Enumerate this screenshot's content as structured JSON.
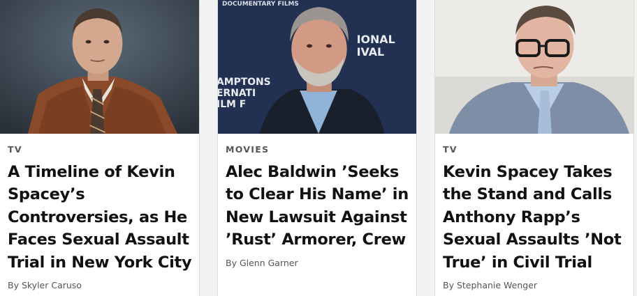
{
  "articles": [
    {
      "category": "TV",
      "headline": "A Timeline of Kevin Spacey’s Controversies, as He Faces Sexual Assault Trial in New York City",
      "byline": "By Skyler Caruso"
    },
    {
      "category": "MOVIES",
      "headline": "Alec Baldwin ’Seeks to Clear His Name’ in New Lawsuit Against ’Rust’ Armorer, Crew",
      "byline": "By Glenn Garner",
      "image_backdrop_text": [
        "DOCUMENTARY FILMS",
        "IONAL",
        "IVAL",
        "AMPTONS",
        "ERNATI",
        "ILM F"
      ]
    },
    {
      "category": "TV",
      "headline": "Kevin Spacey Takes the Stand and Calls Anthony Rapp’s Sexual Assaults ’Not True’ in Civil Trial",
      "byline": "By Stephanie Wenger"
    }
  ],
  "colors": {
    "category_text": "#555555",
    "headline_text": "#111111",
    "page_background": "#f2f2f2",
    "card_background": "#ffffff"
  }
}
